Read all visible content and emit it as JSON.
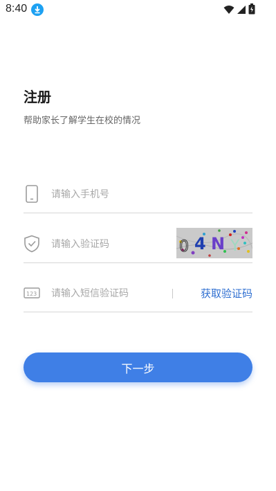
{
  "status_bar": {
    "time": "8:40",
    "icons": [
      "download-icon",
      "wifi-icon",
      "signal-icon",
      "battery-icon"
    ]
  },
  "header": {
    "title": "注册",
    "subtitle": "帮助家长了解学生在校的情况"
  },
  "form": {
    "phone": {
      "placeholder": "请输入手机号",
      "icon": "phone-icon"
    },
    "captcha": {
      "placeholder": "请输入验证码",
      "icon": "shield-check-icon",
      "code": "04NY"
    },
    "sms": {
      "placeholder": "请输入短信验证码",
      "icon": "sms-code-icon",
      "get_code_label": "获取验证码"
    }
  },
  "actions": {
    "next_label": "下一步"
  },
  "colors": {
    "primary": "#3f7fe6",
    "link": "#2f6fd1",
    "divider": "#d6d6d6",
    "placeholder": "#a8a8a8"
  }
}
